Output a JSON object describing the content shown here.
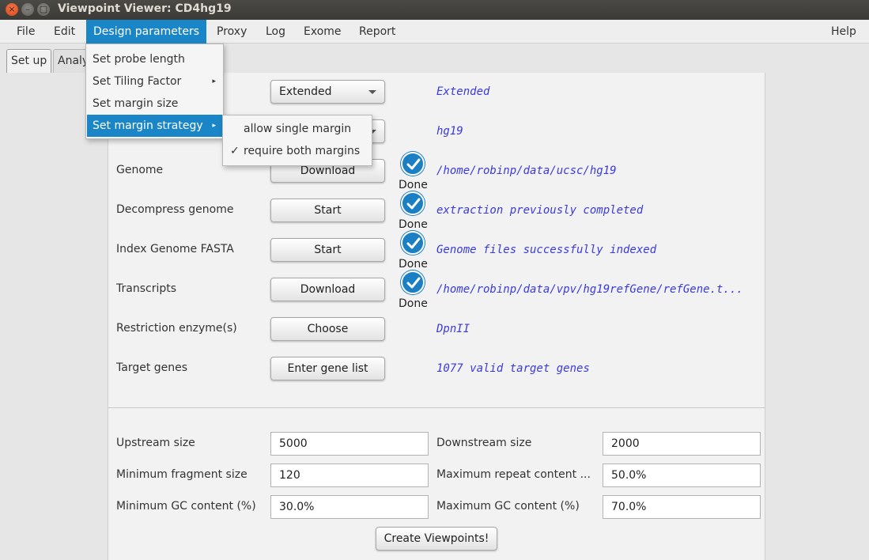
{
  "window": {
    "title": "Viewpoint Viewer: CD4hg19",
    "close_glyph": "×",
    "min_glyph": "–",
    "max_glyph": "▢"
  },
  "menubar": {
    "items": [
      "File",
      "Edit",
      "Design parameters",
      "Proxy",
      "Log",
      "Exome",
      "Report"
    ],
    "help": "Help",
    "active": "Design parameters"
  },
  "tabs": [
    "Set up",
    "Analy"
  ],
  "setup": {
    "approach_value": "Extended",
    "approach_status": "Extended",
    "genome_build_status": "hg19",
    "rows": [
      {
        "label": "Genome",
        "button": "Download",
        "done": "Done",
        "status": "/home/robinp/data/ucsc/hg19"
      },
      {
        "label": "Decompress genome",
        "button": "Start",
        "done": "Done",
        "status": "extraction previously completed"
      },
      {
        "label": "Index Genome FASTA",
        "button": "Start",
        "done": "Done",
        "status": "Genome files successfully indexed"
      },
      {
        "label": "Transcripts",
        "button": "Download",
        "done": "Done",
        "status": "/home/robinp/data/vpv/hg19refGene/refGene.t..."
      },
      {
        "label": "Restriction enzyme(s)",
        "button": "Choose",
        "status": "DpnII"
      },
      {
        "label": "Target genes",
        "button": "Enter gene list",
        "status": "1077 valid target genes"
      }
    ]
  },
  "params": {
    "upstream_label": "Upstream size",
    "upstream_value": "5000",
    "downstream_label": "Downstream size",
    "downstream_value": "2000",
    "min_frag_label": "Minimum fragment size",
    "min_frag_value": "120",
    "max_repeat_label": "Maximum repeat content ...",
    "max_repeat_value": "50.0%",
    "min_gc_label": "Minimum GC content (%)",
    "min_gc_value": "30.0%",
    "max_gc_label": "Maximum GC content (%)",
    "max_gc_value": "70.0%",
    "create_button": "Create Viewpoints!"
  },
  "design_menu": {
    "items": [
      "Set probe length",
      "Set Tiling Factor",
      "Set margin size",
      "Set margin strategy"
    ],
    "submenu_arrow": "▸",
    "highlighted": "Set margin strategy"
  },
  "margin_submenu": {
    "items": [
      "allow single margin",
      "require both margins"
    ],
    "checked": "require both margins",
    "check_glyph": "✓"
  },
  "colors": {
    "accent": "#1a86c8",
    "status_text": "#3a3adf",
    "check_circle": "#1b7fc4"
  },
  "icons": [
    "close-icon",
    "minimize-icon",
    "maximize-icon",
    "chevron-down-icon",
    "checkmark-icon",
    "submenu-arrow-icon"
  ]
}
